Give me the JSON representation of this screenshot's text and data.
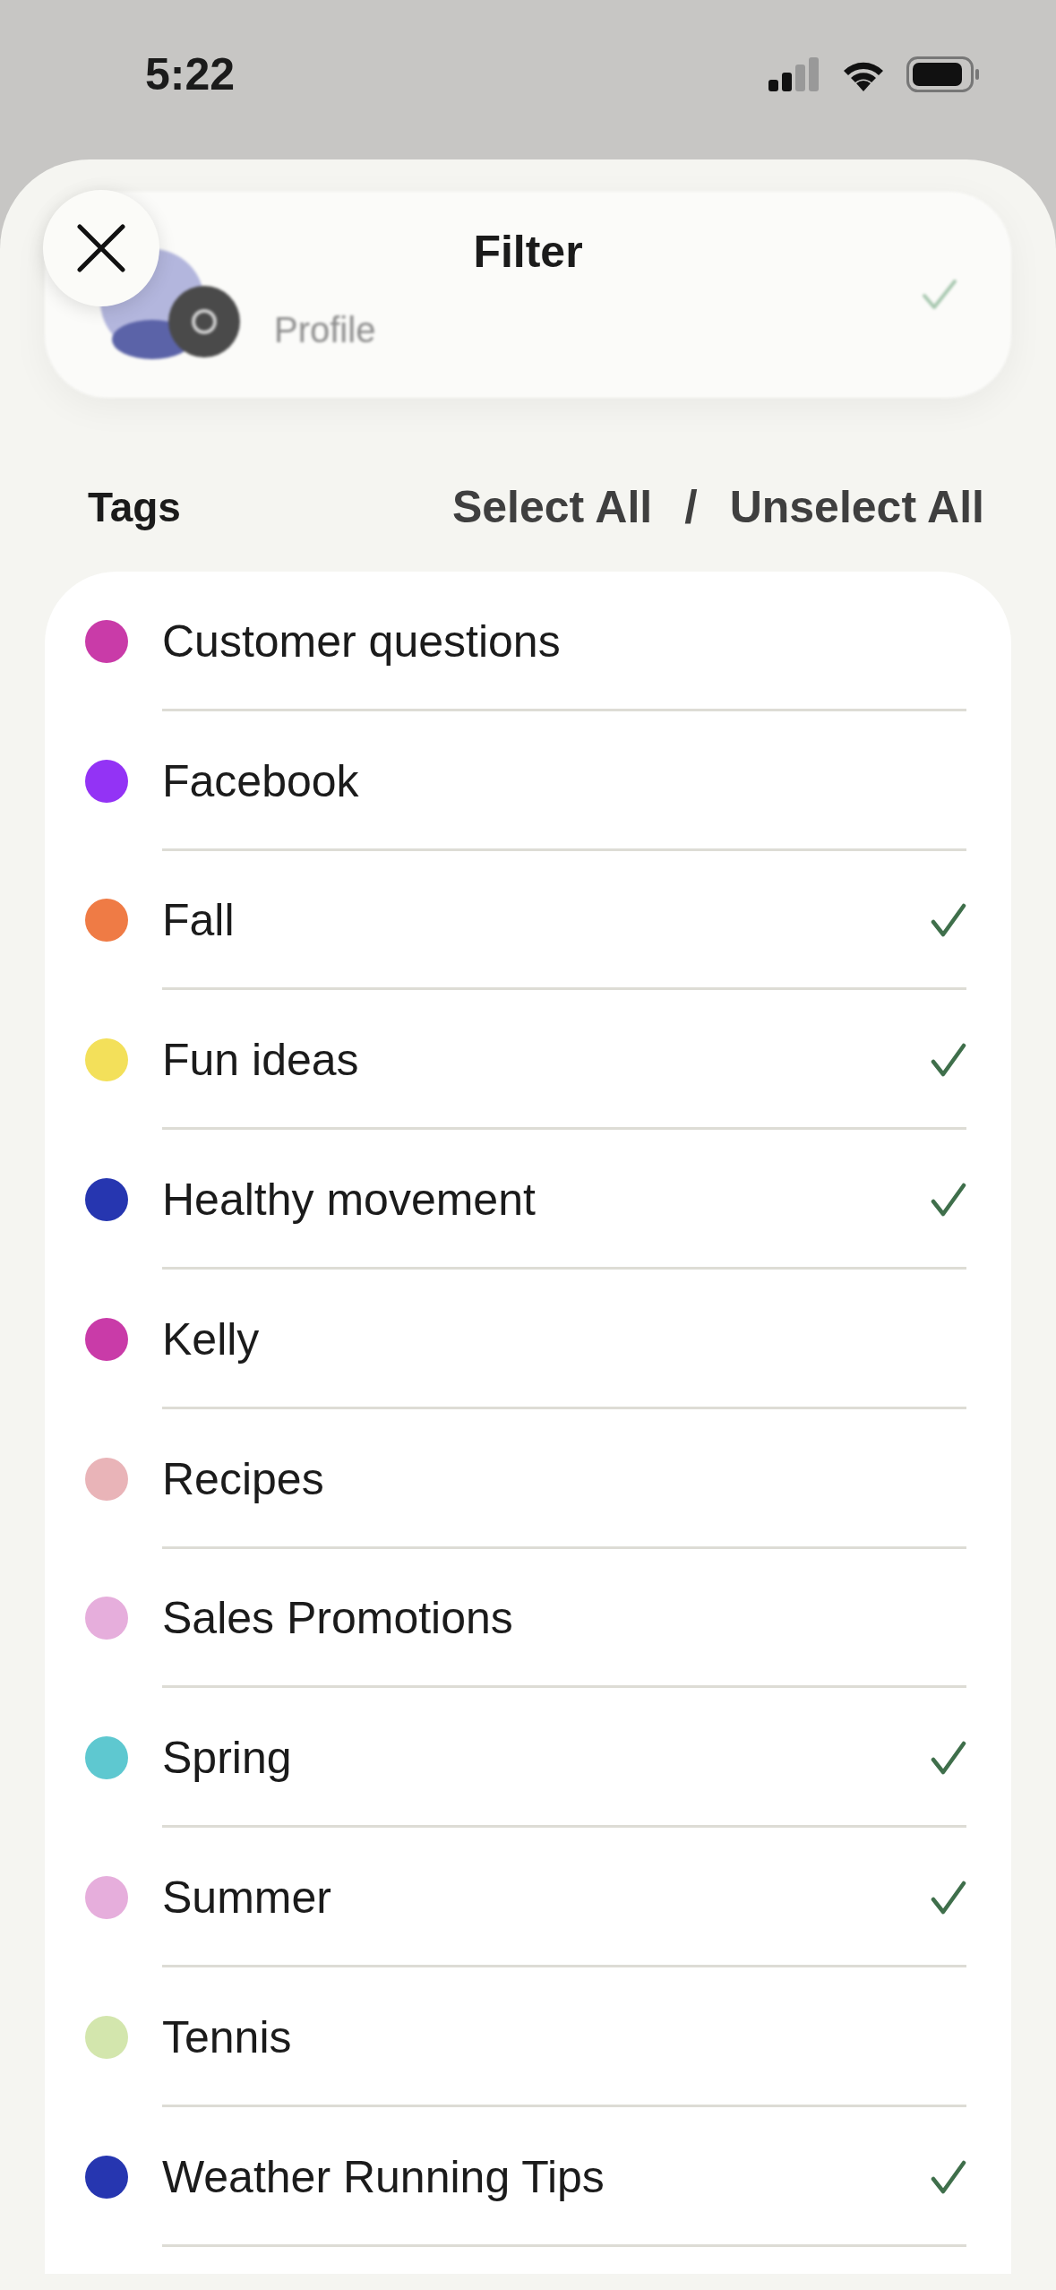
{
  "status_bar": {
    "time": "5:22"
  },
  "header": {
    "title": "Filter"
  },
  "profile_card": {
    "subtitle": "Profile",
    "selected": true
  },
  "tags_section": {
    "title": "Tags",
    "select_all": "Select All",
    "separator": "/",
    "unselect_all": "Unselect All"
  },
  "tags": [
    {
      "name": "Customer questions",
      "color": "#c93ba8",
      "selected": false
    },
    {
      "name": "Facebook",
      "color": "#9333f5",
      "selected": false
    },
    {
      "name": "Fall",
      "color": "#ef7b45",
      "selected": true
    },
    {
      "name": "Fun ideas",
      "color": "#f3e05a",
      "selected": true
    },
    {
      "name": "Healthy movement",
      "color": "#2636b0",
      "selected": true
    },
    {
      "name": "Kelly",
      "color": "#c93ba8",
      "selected": false
    },
    {
      "name": "Recipes",
      "color": "#e9b4b8",
      "selected": false
    },
    {
      "name": "Sales Promotions",
      "color": "#e6aedc",
      "selected": false
    },
    {
      "name": "Spring",
      "color": "#5ec8d0",
      "selected": true
    },
    {
      "name": "Summer",
      "color": "#e6aedc",
      "selected": true
    },
    {
      "name": "Tennis",
      "color": "#d3e6ad",
      "selected": false
    },
    {
      "name": "Weather Running Tips",
      "color": "#2636b0",
      "selected": true
    }
  ]
}
